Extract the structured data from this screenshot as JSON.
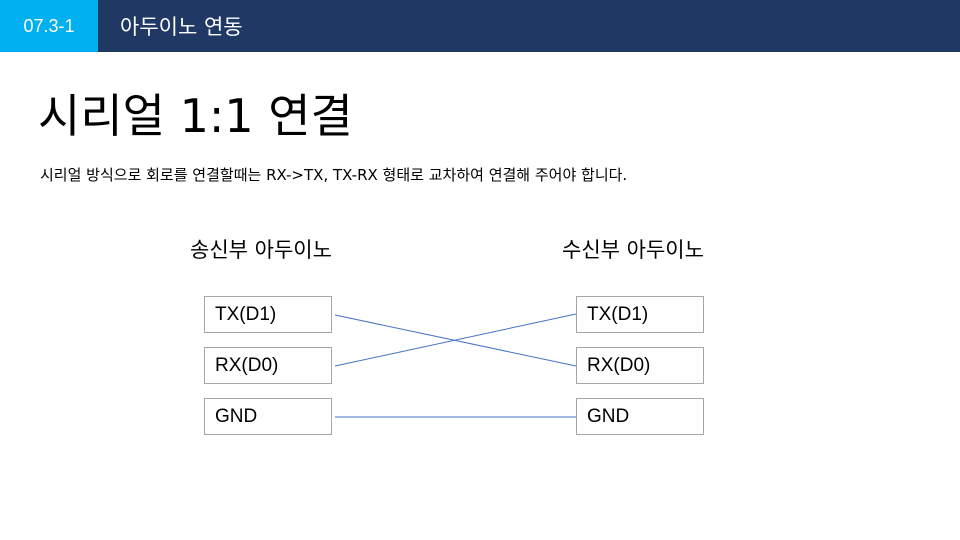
{
  "header": {
    "section_number": "07.3-1",
    "title": "아두이노 연동"
  },
  "slide": {
    "title": "시리얼 1:1 연결",
    "description": "시리얼 방식으로 회로를 연결할때는 RX->TX, TX-RX 형태로 교차하여 연결해 주어야 합니다."
  },
  "diagram": {
    "sender_label": "송신부 아두이노",
    "receiver_label": "수신부 아두이노",
    "sender_pins": [
      "TX(D1)",
      "RX(D0)",
      "GND"
    ],
    "receiver_pins": [
      "TX(D1)",
      "RX(D0)",
      "GND"
    ],
    "connections": [
      {
        "from": "TX(D1)",
        "to": "RX(D0)"
      },
      {
        "from": "RX(D0)",
        "to": "TX(D1)"
      },
      {
        "from": "GND",
        "to": "GND"
      }
    ],
    "wire_color": "#4472c4",
    "box_border_color": "#a6a6a6"
  },
  "colors": {
    "header_bar": "#1f3864",
    "badge": "#00b0f0"
  }
}
